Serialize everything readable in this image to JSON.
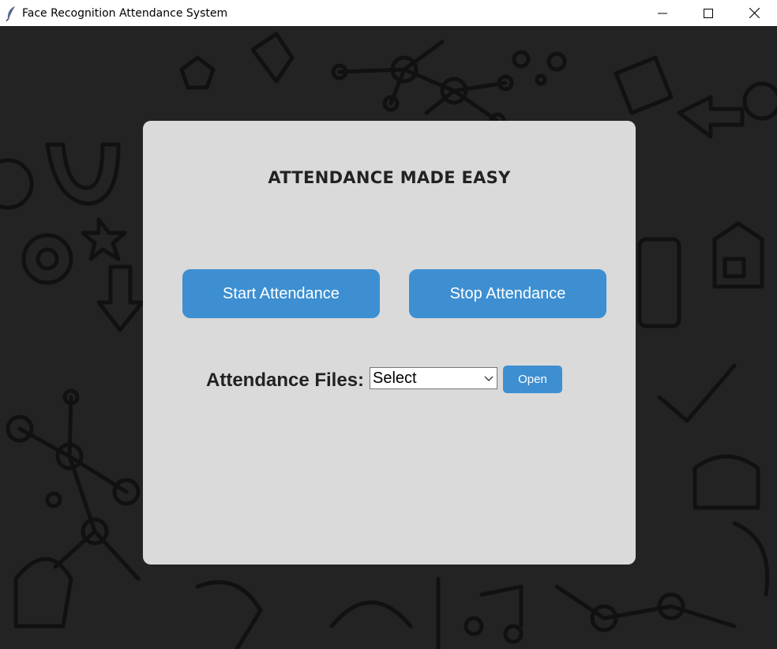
{
  "window": {
    "title": "Face Recognition Attendance System",
    "app_icon": "feather-icon",
    "controls": [
      "minimize-icon",
      "maximize-icon",
      "close-icon"
    ]
  },
  "panel": {
    "heading": "ATTENDANCE MADE EASY",
    "start_button_label": "Start Attendance",
    "stop_button_label": "Stop Attendance",
    "files_label": "Attendance Files:",
    "files_select_value": "Select",
    "open_button_label": "Open"
  },
  "colors": {
    "accent": "#3d8fd1",
    "panel_bg": "#dadada",
    "background": "#232323",
    "text": "#222222"
  }
}
